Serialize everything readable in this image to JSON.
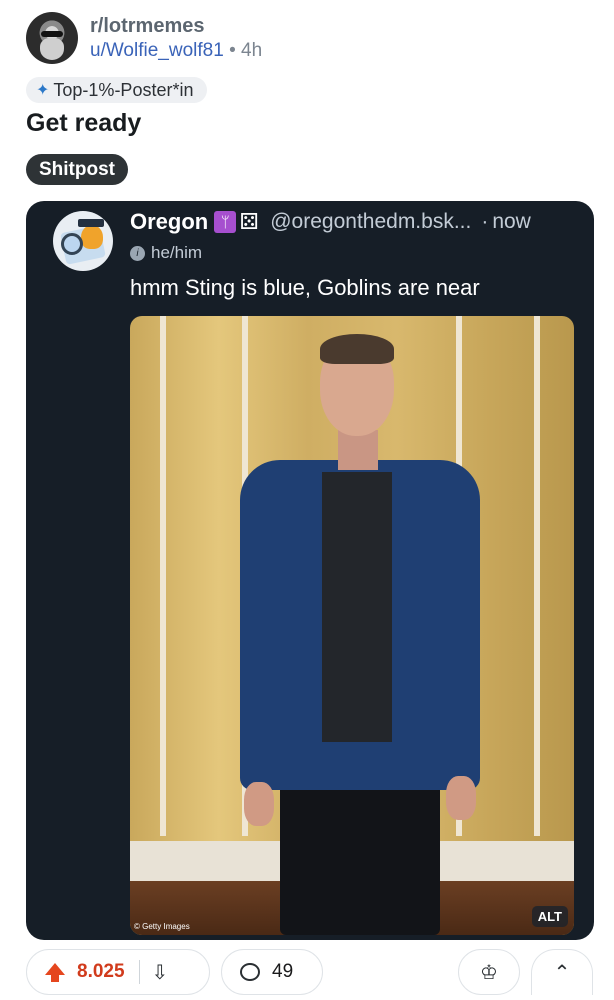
{
  "post": {
    "subreddit": "r/lotrmemes",
    "username": "u/Wolfie_wolf81",
    "separator": "•",
    "time": "4h",
    "user_flair": "Top-1%-Poster*in",
    "title": "Get ready",
    "tag": "Shitpost"
  },
  "embed": {
    "name": "Oregon",
    "handle": "@oregonthedm.bsk...",
    "separator": "·",
    "time": "now",
    "pronouns": "he/him",
    "text": "hmm Sting is blue, Goblins are near",
    "image_credit": "Getty Images",
    "alt_label": "ALT"
  },
  "actions": {
    "score": "8.025",
    "comments": "49"
  },
  "colors": {
    "upvote": "#e5461e",
    "embed_bg": "#161e27",
    "username": "#3a63b8"
  }
}
